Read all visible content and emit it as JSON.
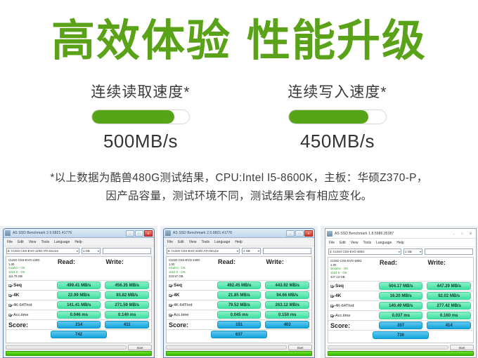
{
  "hero": {
    "title_part1": "高效体验",
    "title_part2": "性能升级",
    "color": "#5aa319"
  },
  "speeds": [
    {
      "label": "连续读取速度*",
      "value": "500MB/s",
      "fill_percent": 85,
      "bar_color": "#55a516"
    },
    {
      "label": "连续写入速度*",
      "value": "450MB/s",
      "fill_percent": 82,
      "bar_color": "#55a516"
    }
  ],
  "disclaimer": {
    "line1": "*以上数据为酷兽480G测试结果，CPU:Intel I5-8600K，主板：华硕Z370-P，",
    "line2": "因产品容量，测试环境不同，测试结果会有相应变化。"
  },
  "benchmark": {
    "menu": [
      "File",
      "Edit",
      "View",
      "Tools",
      "Language",
      "Help"
    ],
    "column_read": "Read:",
    "column_write": "Write:",
    "row_labels": {
      "seq": "Seq",
      "k4": "4K",
      "k4_64": "4K-64Thrd",
      "acc": "Acc.time",
      "score": "Score:"
    },
    "start_button": "Start",
    "size_option": "1 GB",
    "panels": [
      {
        "window_title": "AS SSD Benchmark 2.0.6821.41776",
        "device_combo": "8: CUSO CSS-EVO 120G ATA Device",
        "drive_name": "CUSO CSS-EVO 120G",
        "firmware": "1.00",
        "driver": "msahci - OK",
        "alignment": "1024 K - OK",
        "capacity": "111.79 GB",
        "seq_read": "499.41 MB/s",
        "seq_write": "456.35 MB/s",
        "k4_read": "22.99 MB/s",
        "k4_write": "93.82 MB/s",
        "k4_64_read": "141.41 MB/s",
        "k4_64_write": "271.59 MB/s",
        "acc_read": "0.046 ms",
        "acc_write": "0.140 ms",
        "score_read": "214",
        "score_write": "411",
        "score_total": "742",
        "style": "aero"
      },
      {
        "window_title": "AS SSD Benchmark 2.0.6821.41776",
        "device_combo": "8: CUSO CSS-EVO 240G ATA Device",
        "drive_name": "CUSO CSS-EVO 240G",
        "firmware": "1.00",
        "driver": "msahci - OK",
        "alignment": "1024 K - OK",
        "capacity": "223.57 GB",
        "seq_read": "492.45 MB/s",
        "seq_write": "443.92 MB/s",
        "k4_read": "21.85 MB/s",
        "k4_write": "94.66 MB/s",
        "k4_64_read": "79.52 MB/s",
        "k4_64_write": "263.12 MB/s",
        "acc_read": "0.045 ms",
        "acc_write": "0.150 ms",
        "score_read": "151",
        "score_write": "402",
        "score_total": "637",
        "style": "aero"
      },
      {
        "window_title": "AS SSD Benchmark 1.8.5986.35387",
        "device_combo": "3: CUSO CSS-EVO 480G",
        "drive_name": "CUSO CSS-EVO 480G",
        "firmware": "1.00",
        "driver": "storahci - OK",
        "alignment": "1024 K - OK",
        "capacity": "447.13 GB",
        "seq_read": "504.17 MB/s",
        "seq_write": "447.29 MB/s",
        "k4_read": "16.20 MB/s",
        "k4_write": "92.02 MB/s",
        "k4_64_read": "140.49 MB/s",
        "k4_64_write": "277.42 MB/s",
        "acc_read": "0.037 ms",
        "acc_write": "0.160 ms",
        "score_read": "207",
        "score_write": "414",
        "score_total": "730",
        "style": "flat"
      }
    ]
  }
}
